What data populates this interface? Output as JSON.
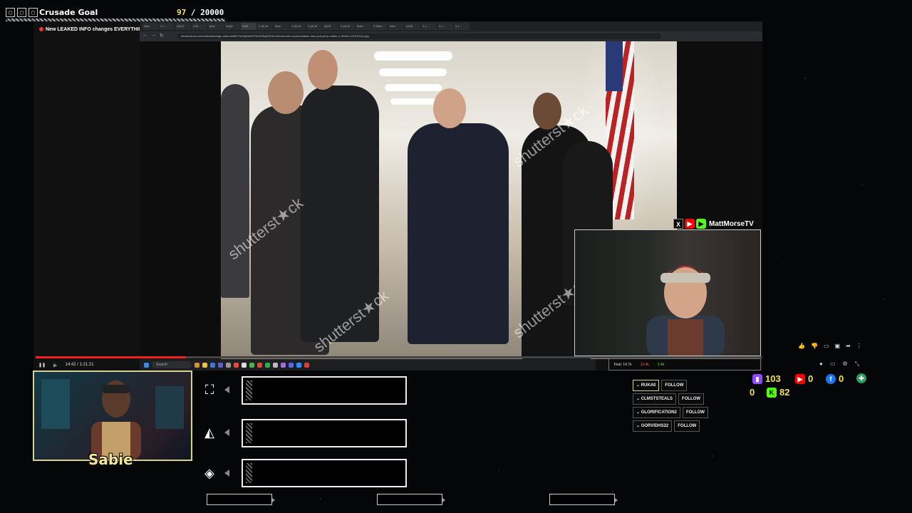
{
  "goal": {
    "icons": [
      "▢",
      "▢",
      "▢"
    ],
    "title": "Crusade Goal",
    "current": "97",
    "target": "/ 20000"
  },
  "video_title": "New LEAKED INFO changes EVERYTHING.",
  "browser": {
    "tabs": [
      "New",
      "X (…",
      "(36) A",
      "(78) …",
      "jerry",
      "origin",
      "Nadl",
      "X (8) M",
      "New",
      "X (6) M",
      "X (8) M",
      "(8) M",
      "X (4) M",
      "Marc",
      "X Marc",
      "New",
      "(100)",
      "X (…",
      "X (…",
      "X (…"
    ],
    "url": "shutterstock.com/editorial/image-editorial/M0TbA3yBMzI37Ne5NDg3ODA=/democratic-representative-new-york-jerry-nadler-c-1500w-10167612c.jpg",
    "nav": [
      "←",
      "→",
      "↻"
    ]
  },
  "watermark": "shutterst★ck",
  "webcam": {
    "channel": "MattMorseTV",
    "icons": [
      "X",
      "▶",
      "▶"
    ]
  },
  "player": {
    "time": "14:42 / 1:21:21",
    "progress_fraction": 0.207,
    "search_label": "Search",
    "stats": [
      "Total: 14.7k",
      "12.4k",
      "2.4k"
    ]
  },
  "streamer": {
    "name": "Sabie"
  },
  "alerts": {
    "icons": [
      "⛶",
      "◭",
      "◈"
    ]
  },
  "follows": [
    {
      "user": "RUKA0",
      "tag": "FOLLOW"
    },
    {
      "user": "CLMSTSTEALS",
      "tag": "FOLLOW"
    },
    {
      "user": "GLORIFICATION2",
      "tag": "FOLLOW"
    },
    {
      "user": "GORVIDHS22",
      "tag": "FOLLOW"
    }
  ],
  "social": {
    "twitch": "103",
    "youtube": "0",
    "facebook": "0",
    "other": "0",
    "kick": "82"
  },
  "colors": {
    "accent_yellow": "#f1e25a",
    "twitch": "#9146ff",
    "youtube": "#ff0000",
    "facebook": "#1877f2",
    "kick": "#53fc18"
  }
}
